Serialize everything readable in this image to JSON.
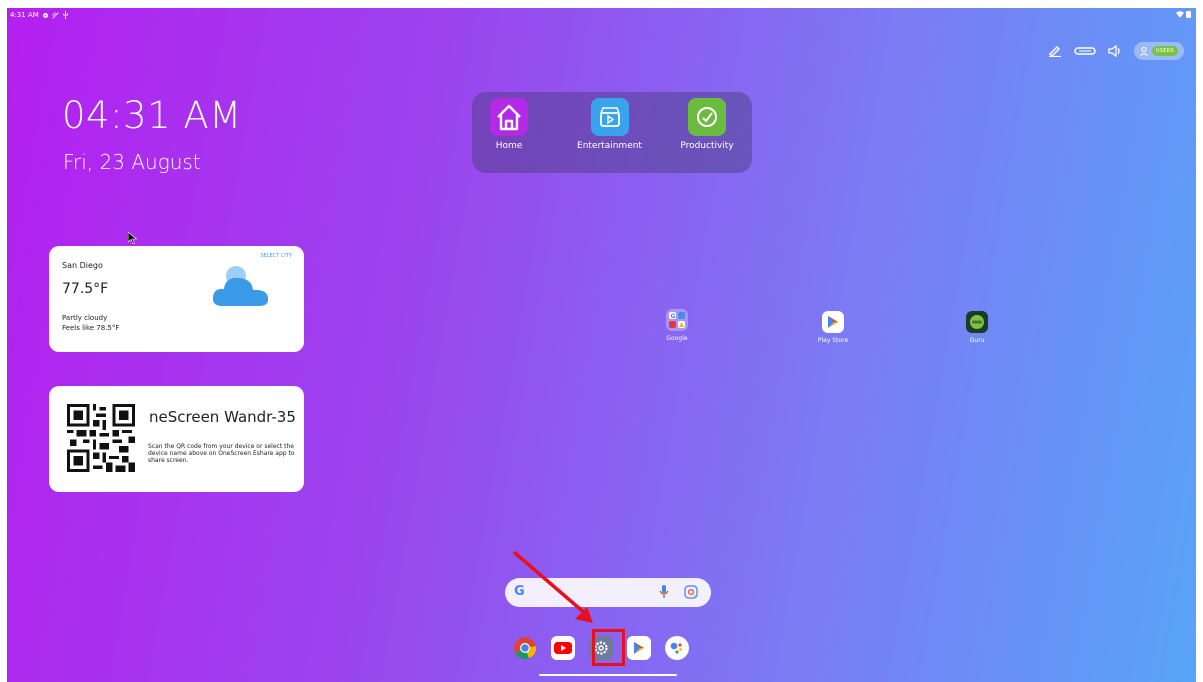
{
  "status_bar": {
    "time": "4:31 AM"
  },
  "tray": {
    "users_label": "USERS"
  },
  "clock": {
    "time": "04:31 AM",
    "date": "Fri, 23 August"
  },
  "categories": [
    {
      "label": "Home",
      "color": "#b22ae6",
      "icon": "house-icon"
    },
    {
      "label": "Entertainment",
      "color": "#3aa3ee",
      "icon": "clapperboard-icon"
    },
    {
      "label": "Productivity",
      "color": "#6bbb3e",
      "icon": "gauge-icon"
    }
  ],
  "weather": {
    "select_city": "SELECT CITY",
    "city": "San Diego",
    "temperature": "77.5°F",
    "condition": "Partly cloudy",
    "feels_like": "Feels like 78.5°F"
  },
  "screenshare": {
    "device_name": "neScreen Wandr-35",
    "instructions": "Scan the QR code from your device or select the device name above on OneScreen Eshare app to share screen."
  },
  "desktop_apps": [
    {
      "label": "Google",
      "icon": "google-folder-icon"
    },
    {
      "label": "Play Store",
      "icon": "play-store-icon"
    },
    {
      "label": "Guru",
      "icon": "guru-icon"
    }
  ],
  "search": {
    "logo": "G"
  },
  "dock": [
    {
      "name": "chrome-icon"
    },
    {
      "name": "youtube-icon"
    },
    {
      "name": "settings-icon"
    },
    {
      "name": "play-store-icon"
    },
    {
      "name": "assistant-icon"
    }
  ]
}
